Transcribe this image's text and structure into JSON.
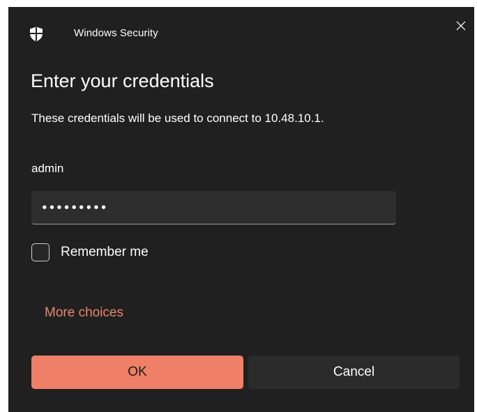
{
  "window": {
    "app_title": "Windows Security",
    "icon": "shield-icon",
    "close_icon": "close-icon"
  },
  "dialog": {
    "heading": "Enter your credentials",
    "description": "These credentials will be used to connect to 10.48.10.1.",
    "username": "admin",
    "password_masked": "•••••••••",
    "remember_me": {
      "label": "Remember me",
      "checked": false
    },
    "more_choices": "More choices",
    "buttons": {
      "ok": "OK",
      "cancel": "Cancel"
    }
  },
  "colors": {
    "background": "#202020",
    "accent": "#f07f68",
    "link": "#e8876b",
    "field": "#2d2d2d",
    "secondary_button": "#2b2b2b"
  }
}
